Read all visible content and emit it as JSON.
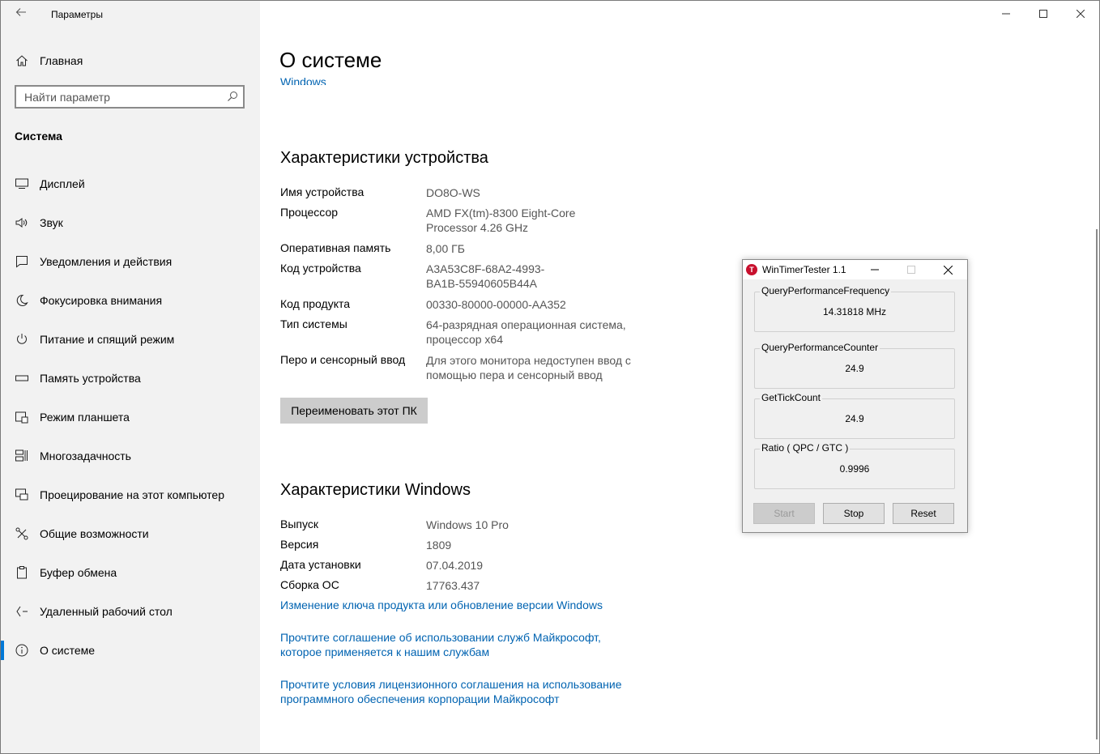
{
  "app": {
    "title": "Параметры",
    "back_icon": "back-arrow-icon"
  },
  "sidebar": {
    "home_label": "Главная",
    "search_placeholder": "Найти параметр",
    "section": "Система",
    "items": [
      {
        "label": "Дисплей",
        "icon": "display-icon"
      },
      {
        "label": "Звук",
        "icon": "sound-icon"
      },
      {
        "label": "Уведомления и действия",
        "icon": "notifications-icon"
      },
      {
        "label": "Фокусировка внимания",
        "icon": "focus-moon-icon"
      },
      {
        "label": "Питание и спящий режим",
        "icon": "power-icon"
      },
      {
        "label": "Память устройства",
        "icon": "storage-icon"
      },
      {
        "label": "Режим планшета",
        "icon": "tablet-icon"
      },
      {
        "label": "Многозадачность",
        "icon": "multitasking-icon"
      },
      {
        "label": "Проецирование на этот компьютер",
        "icon": "projecting-icon"
      },
      {
        "label": "Общие возможности",
        "icon": "shared-experiences-icon"
      },
      {
        "label": "Буфер обмена",
        "icon": "clipboard-icon"
      },
      {
        "label": "Удаленный рабочий стол",
        "icon": "remote-desktop-icon"
      },
      {
        "label": "О системе",
        "icon": "info-icon",
        "active": true
      }
    ]
  },
  "main": {
    "title": "О системе",
    "cut_link": "Windows",
    "device_heading": "Характеристики устройства",
    "device_specs": [
      {
        "key": "Имя устройства",
        "value": "DO8O-WS"
      },
      {
        "key": "Процессор",
        "value": "AMD FX(tm)-8300 Eight-Core Processor 4.26 GHz"
      },
      {
        "key": "Оперативная память",
        "value": "8,00 ГБ"
      },
      {
        "key": "Код устройства",
        "value": "A3A53C8F-68A2-4993-BA1B-55940605B44A"
      },
      {
        "key": "Код продукта",
        "value": "00330-80000-00000-AA352"
      },
      {
        "key": "Тип системы",
        "value": "64-разрядная операционная система, процессор x64"
      },
      {
        "key": "Перо и сенсорный ввод",
        "value": "Для этого монитора недоступен ввод с помощью пера и сенсорный ввод"
      }
    ],
    "rename_button": "Переименовать этот ПК",
    "windows_heading": "Характеристики Windows",
    "windows_specs": [
      {
        "key": "Выпуск",
        "value": "Windows 10 Pro"
      },
      {
        "key": "Версия",
        "value": "1809"
      },
      {
        "key": "Дата установки",
        "value": "07.04.2019"
      },
      {
        "key": "Сборка ОС",
        "value": "17763.437"
      }
    ],
    "links": [
      "Изменение ключа продукта или обновление версии Windows",
      "Прочтите соглашение об использовании служб Майкрософт, которое применяется к нашим службам",
      "Прочтите условия лицензионного соглашения на использование программного обеспечения корпорации Майкрософт"
    ]
  },
  "dialog": {
    "title": "WinTimerTester 1.1",
    "icon_letter": "T",
    "groups": [
      {
        "label": "QueryPerformanceFrequency",
        "value": "14.31818 MHz"
      },
      {
        "label": "QueryPerformanceCounter",
        "value": "24.9"
      },
      {
        "label": "GetTickCount",
        "value": "24.9"
      },
      {
        "label": "Ratio  ( QPC / GTC )",
        "value": "0.9996"
      }
    ],
    "buttons": {
      "start": "Start",
      "stop": "Stop",
      "reset": "Reset"
    }
  },
  "colors": {
    "accent": "#0078d7",
    "link": "#0063b1",
    "sidebar_bg": "#f2f2f2",
    "dialog_icon": "#c8102e"
  }
}
